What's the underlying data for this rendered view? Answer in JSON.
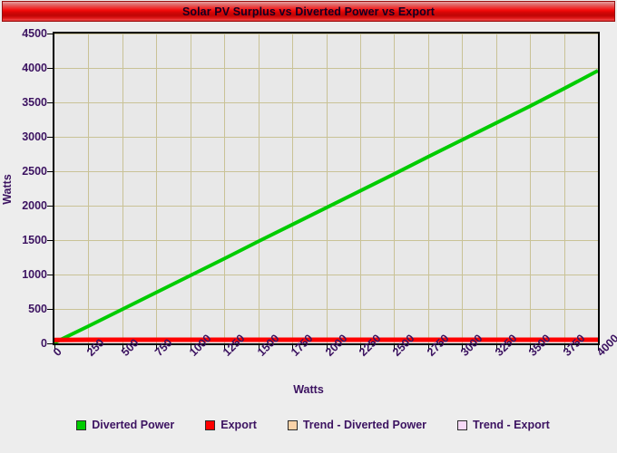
{
  "title": "Solar PV Surplus vs Diverted Power vs Export",
  "colors": {
    "title_bar_red": "#f20808",
    "plot_background": "#e8e8e8",
    "page_background": "#ededed",
    "gridline": "#c9c296",
    "axis": "#000000",
    "tick_text": "#3c1361",
    "diverted_power": "#00cc00",
    "export": "#ff0000",
    "trend_diverted_power": "#fad2a8",
    "trend_export": "#f6d9f6"
  },
  "legend": {
    "items": [
      {
        "label": "Diverted Power",
        "color": "#00cc00"
      },
      {
        "label": "Export",
        "color": "#ff0000"
      },
      {
        "label": "Trend - Diverted Power",
        "color": "#fad2a8"
      },
      {
        "label": "Trend - Export",
        "color": "#f6d9f6"
      }
    ]
  },
  "chart_data": {
    "type": "line",
    "title": "Solar PV Surplus vs Diverted Power vs Export",
    "xlabel": "Watts",
    "ylabel": "Watts",
    "xlim": [
      0,
      4000
    ],
    "ylim": [
      0,
      4500
    ],
    "grid": true,
    "legend_position": "bottom",
    "xticks": [
      0,
      250,
      500,
      750,
      1000,
      1250,
      1500,
      1750,
      2000,
      2250,
      2500,
      2750,
      3000,
      3250,
      3500,
      3750,
      4000
    ],
    "yticks": [
      0,
      500,
      1000,
      1500,
      2000,
      2500,
      3000,
      3500,
      4000,
      4500
    ],
    "xtick_labels": [
      "0",
      "250",
      "500",
      "750",
      "1000",
      "1250",
      "1500",
      "1750",
      "2000",
      "2250",
      "2500",
      "2750",
      "3000",
      "3250",
      "3500",
      "3750",
      "4000"
    ],
    "ytick_labels": [
      "0",
      "500",
      "1000",
      "1500",
      "2000",
      "2500",
      "3000",
      "3500",
      "4000",
      "4500"
    ],
    "series": [
      {
        "name": "Diverted Power",
        "color": "#00cc00",
        "x": [
          0,
          250,
          500,
          750,
          1000,
          1250,
          1500,
          1750,
          2000,
          2250,
          2500,
          2750,
          3000,
          3250,
          3500,
          3750,
          4000
        ],
        "values": [
          10,
          250,
          495,
          740,
          985,
          1230,
          1480,
          1725,
          1970,
          2215,
          2460,
          2710,
          2955,
          3200,
          3445,
          3700,
          3960
        ]
      },
      {
        "name": "Export",
        "color": "#ff0000",
        "x": [
          0,
          250,
          500,
          750,
          1000,
          1250,
          1500,
          1750,
          2000,
          2250,
          2500,
          2750,
          3000,
          3250,
          3500,
          3750,
          4000
        ],
        "values": [
          50,
          52,
          52,
          52,
          52,
          52,
          52,
          52,
          52,
          52,
          52,
          52,
          52,
          52,
          52,
          52,
          52
        ]
      },
      {
        "name": "Trend - Diverted Power",
        "color": "#fad2a8",
        "x": [],
        "values": []
      },
      {
        "name": "Trend - Export",
        "color": "#f6d9f6",
        "x": [],
        "values": []
      }
    ]
  }
}
